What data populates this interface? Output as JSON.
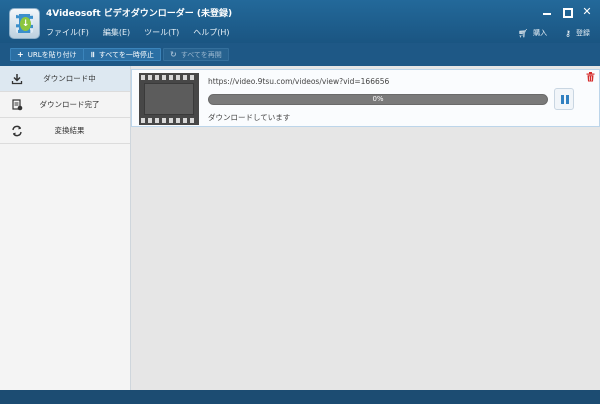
{
  "app": {
    "title": "4Videosoft ビデオダウンローダー (未登録)"
  },
  "menu": [
    "ファイル(F)",
    "編集(E)",
    "ツール(T)",
    "ヘルプ(H)"
  ],
  "top_links": {
    "purchase": "購入",
    "register": "登録"
  },
  "toolbar": {
    "paste_url": "URLを貼り付け",
    "pause_all": "すべてを一時停止",
    "resume_all": "すべてを再開"
  },
  "sidebar": {
    "items": [
      {
        "label": "ダウンロード中",
        "icon": "download-icon",
        "active": true
      },
      {
        "label": "ダウンロード完了",
        "icon": "downloaded-file-icon",
        "active": false
      },
      {
        "label": "変換結果",
        "icon": "convert-icon",
        "active": false
      }
    ]
  },
  "task": {
    "url": "https://video.9tsu.com/videos/view?vid=166656",
    "progress_percent": 0,
    "progress_text": "0%",
    "status": "ダウンロードしています"
  },
  "colors": {
    "titlebar": "#1f5e8f",
    "accent": "#2f7fc0",
    "delete": "#d52b2b"
  }
}
